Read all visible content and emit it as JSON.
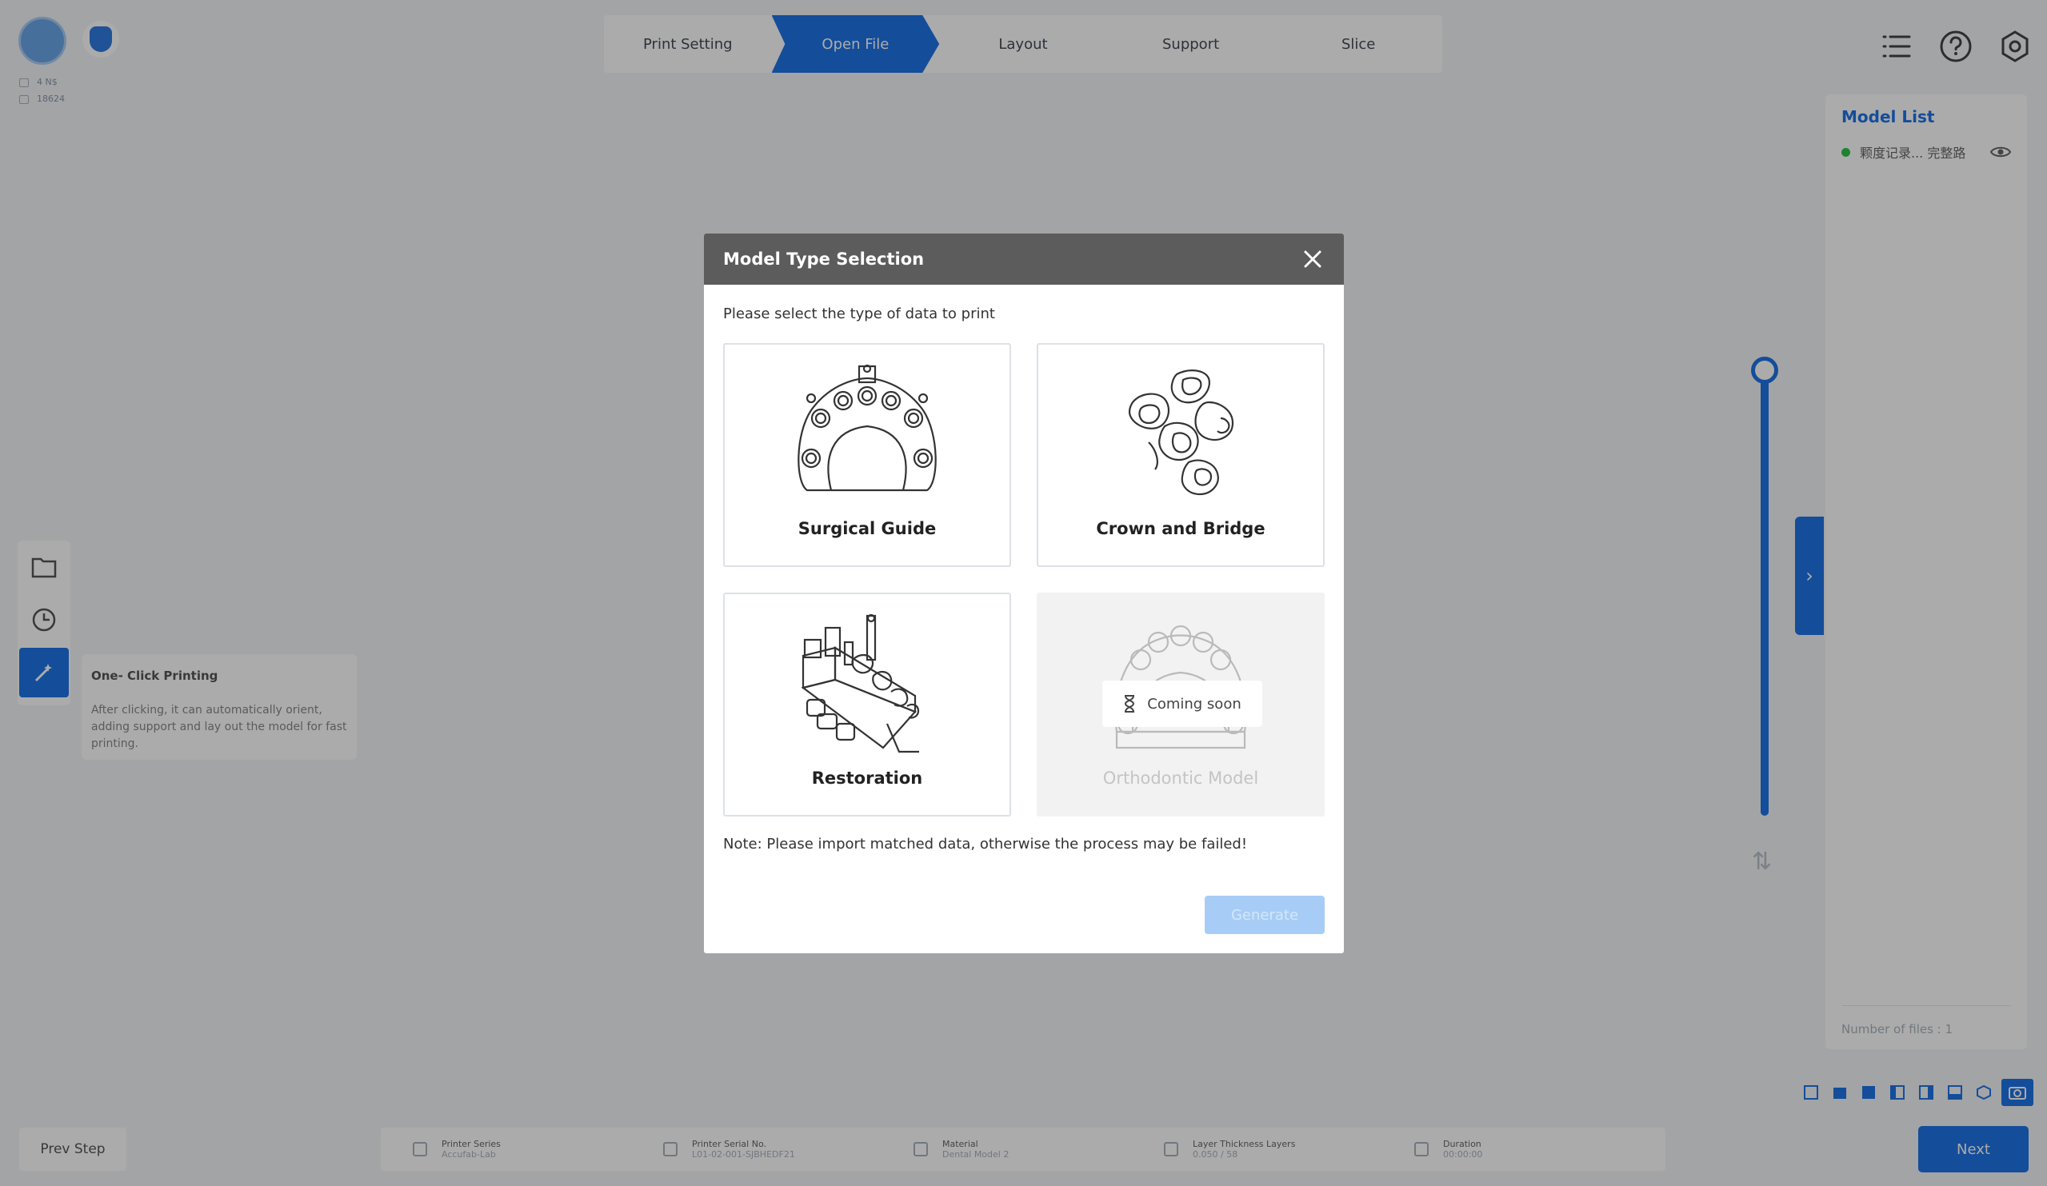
{
  "user": {
    "line1": "4 N$",
    "line2": "18624"
  },
  "steps": [
    {
      "label": "Print Setting",
      "active": false
    },
    {
      "label": "Open File",
      "active": true
    },
    {
      "label": "Layout",
      "active": false
    },
    {
      "label": "Support",
      "active": false
    },
    {
      "label": "Slice",
      "active": false
    }
  ],
  "tooltip": {
    "title": "One- Click Printing",
    "body": "After clicking, it can automatically orient, adding support and lay out the model for fast printing."
  },
  "model_list": {
    "title": "Model List",
    "items": [
      {
        "name": "颗度记录... 完整路"
      }
    ],
    "files_count": "Number of files : 1"
  },
  "bottom": {
    "prev_label": "Prev Step",
    "next_label": "Next",
    "status": [
      {
        "title": "Printer Series",
        "value": "Accufab-Lab",
        "icon": "printer-icon"
      },
      {
        "title": "Printer Serial No.",
        "value": "L01-02-001-SJBHEDF21",
        "icon": "serial-icon"
      },
      {
        "title": "Material",
        "value": "Dental Model 2",
        "icon": "drop-icon"
      },
      {
        "title": "Layer Thickness Layers",
        "value": "0.050 / 58",
        "icon": "layers-icon"
      },
      {
        "title": "Duration",
        "value": "00:00:00",
        "icon": "clock-icon"
      }
    ]
  },
  "dialog": {
    "title": "Model Type Selection",
    "prompt": "Please select the type of data to print",
    "cards": [
      {
        "label": "Surgical Guide",
        "disabled": false
      },
      {
        "label": "Crown and Bridge",
        "disabled": false
      },
      {
        "label": "Restoration",
        "disabled": false
      },
      {
        "label": "Orthodontic Model",
        "disabled": true
      }
    ],
    "coming_soon": "Coming soon",
    "note": "Note: Please import matched data, otherwise the process may be failed!",
    "generate_label": "Generate"
  },
  "colors": {
    "accent": "#1f74e6",
    "header": "#5c5c5c",
    "status_green": "#2cc44a"
  }
}
